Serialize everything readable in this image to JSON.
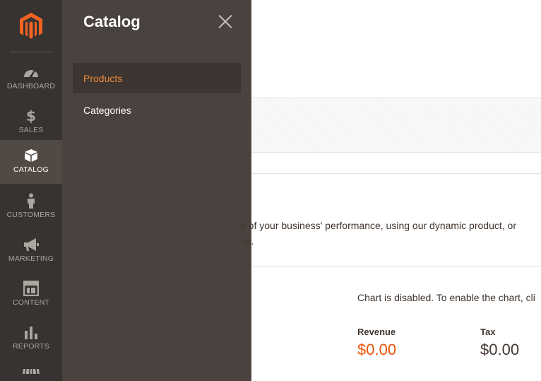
{
  "nav": {
    "logo": "magento-logo",
    "items": [
      {
        "label": "Dashboard",
        "icon": "dashboard-icon"
      },
      {
        "label": "Sales",
        "icon": "dollar-icon"
      },
      {
        "label": "Catalog",
        "icon": "box-icon",
        "active": true
      },
      {
        "label": "Customers",
        "icon": "person-icon"
      },
      {
        "label": "Marketing",
        "icon": "megaphone-icon"
      },
      {
        "label": "Content",
        "icon": "layout-icon"
      },
      {
        "label": "Reports",
        "icon": "bar-chart-icon"
      },
      {
        "label": "",
        "icon": "store-icon"
      }
    ]
  },
  "panel": {
    "title": "Catalog",
    "items": [
      {
        "label": "Products",
        "active": true
      },
      {
        "label": "Categories"
      }
    ]
  },
  "content": {
    "intro_line1": "d of your business' performance, using our dynamic product, or",
    "intro_line2": "ta.",
    "chart_note": "Chart is disabled. To enable the chart, cli",
    "metrics": [
      {
        "label": "Revenue",
        "value": "$0.00"
      },
      {
        "label": "Tax",
        "value": "$0.00"
      }
    ]
  },
  "colors": {
    "nav_bg": "#373330",
    "panel_bg": "#4a423e",
    "accent": "#eb5202",
    "menu_active": "#eb8a3c"
  }
}
